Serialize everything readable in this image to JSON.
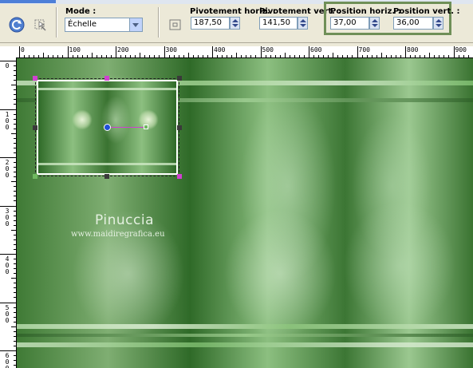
{
  "toolbar": {
    "mode": {
      "label": "Mode :",
      "value": "Échelle"
    },
    "pivot_h": {
      "label": "Pivotement horiz. :",
      "value": "187,50"
    },
    "pivot_v": {
      "label": "Pivotement vert. :",
      "value": "141,50"
    },
    "pos_h": {
      "label": "Position horiz. :",
      "value": "37,00"
    },
    "pos_v": {
      "label": "Position vert. :",
      "value": "36,00"
    }
  },
  "ruler": {
    "h_labels": [
      "0",
      "100",
      "200",
      "300",
      "400",
      "500",
      "600",
      "700",
      "800",
      "900"
    ],
    "v_labels": [
      "0",
      "100",
      "200",
      "300",
      "400",
      "500",
      "600"
    ]
  },
  "canvas": {
    "watermark_name": "Pinuccia",
    "watermark_url": "www.maidiregrafica.eu"
  },
  "colors": {
    "highlight": "#6f8f58",
    "handle_magenta": "#d040d0",
    "handle_green": "#6fb860",
    "handle_dark": "#3a3a3a"
  },
  "icons": [
    "reset-icon",
    "deform-tool-icon",
    "pivot-icon"
  ]
}
